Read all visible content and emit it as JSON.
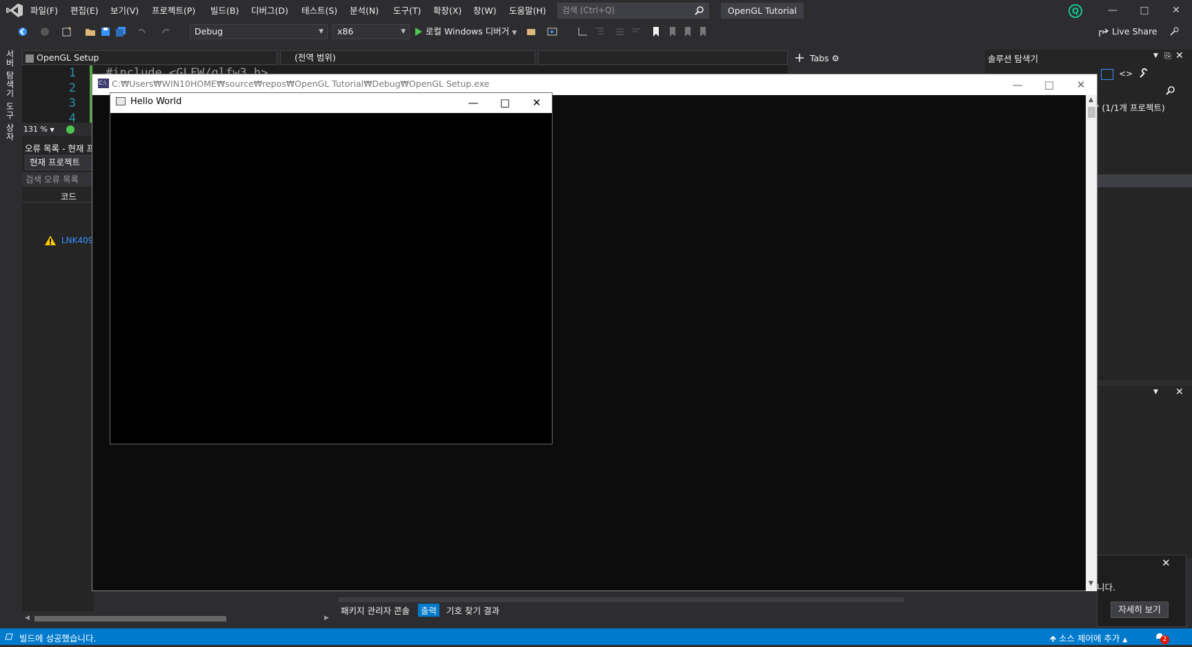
{
  "menu": [
    "파일(F)",
    "편집(E)",
    "보기(V)",
    "프로젝트(P)",
    "빌드(B)",
    "디버그(D)",
    "테스트(S)",
    "분석(N)",
    "도구(T)",
    "확장(X)",
    "창(W)",
    "도움말(H)"
  ],
  "search": {
    "placeholder": "검색 (Ctrl+Q)"
  },
  "solution_title": "OpenGL Tutorial",
  "avatar_letter": "Q",
  "toolbar": {
    "config": "Debug",
    "platform": "x86",
    "run_label": "로컬 Windows 디버거",
    "live_share": "Live Share"
  },
  "left_tabs": [
    "서버 탐색기",
    "도구 상자"
  ],
  "editor": {
    "project_combo": "OpenGL Setup",
    "scope_combo": "(전역 범위)",
    "member_combo": "",
    "line_numbers": [
      "1",
      "2",
      "3",
      "4"
    ],
    "code_line1": "#include <GLFW/glfw3.h>",
    "zoom": "131 %"
  },
  "error_list": {
    "title": "오류 목록 - 현재 프",
    "scope": "현재 프로젝트",
    "search_placeholder": "검색 오류 목록",
    "code_header": "코드",
    "warning_code": "LNK409"
  },
  "tabs_panel": {
    "label": "Tabs"
  },
  "solution_explorer": {
    "title": "솔루션 탐색기",
    "item": "' (1/1개 프로젝트)"
  },
  "notification": {
    "text": "니다.",
    "button": "자세히 보기"
  },
  "output_tabs": [
    "패키지 관리자 콘솔",
    "출력",
    "기호 찾기 결과"
  ],
  "status": {
    "message": "빌드에 성공했습니다.",
    "source_control": "소스 제어에 추가",
    "notifications_count": "2"
  },
  "console": {
    "title": "C:₩Users₩WIN10HOME₩source₩repos₩OpenGL Tutorial₩Debug₩OpenGL Setup.exe"
  },
  "hello_window": {
    "title": "Hello World"
  },
  "colors": {
    "accent": "#007acc",
    "background": "#2d2d30",
    "editor_bg": "#1e1e1e",
    "line_number": "#2b91af",
    "link": "#3794ff",
    "avatar": "#16c98d"
  }
}
